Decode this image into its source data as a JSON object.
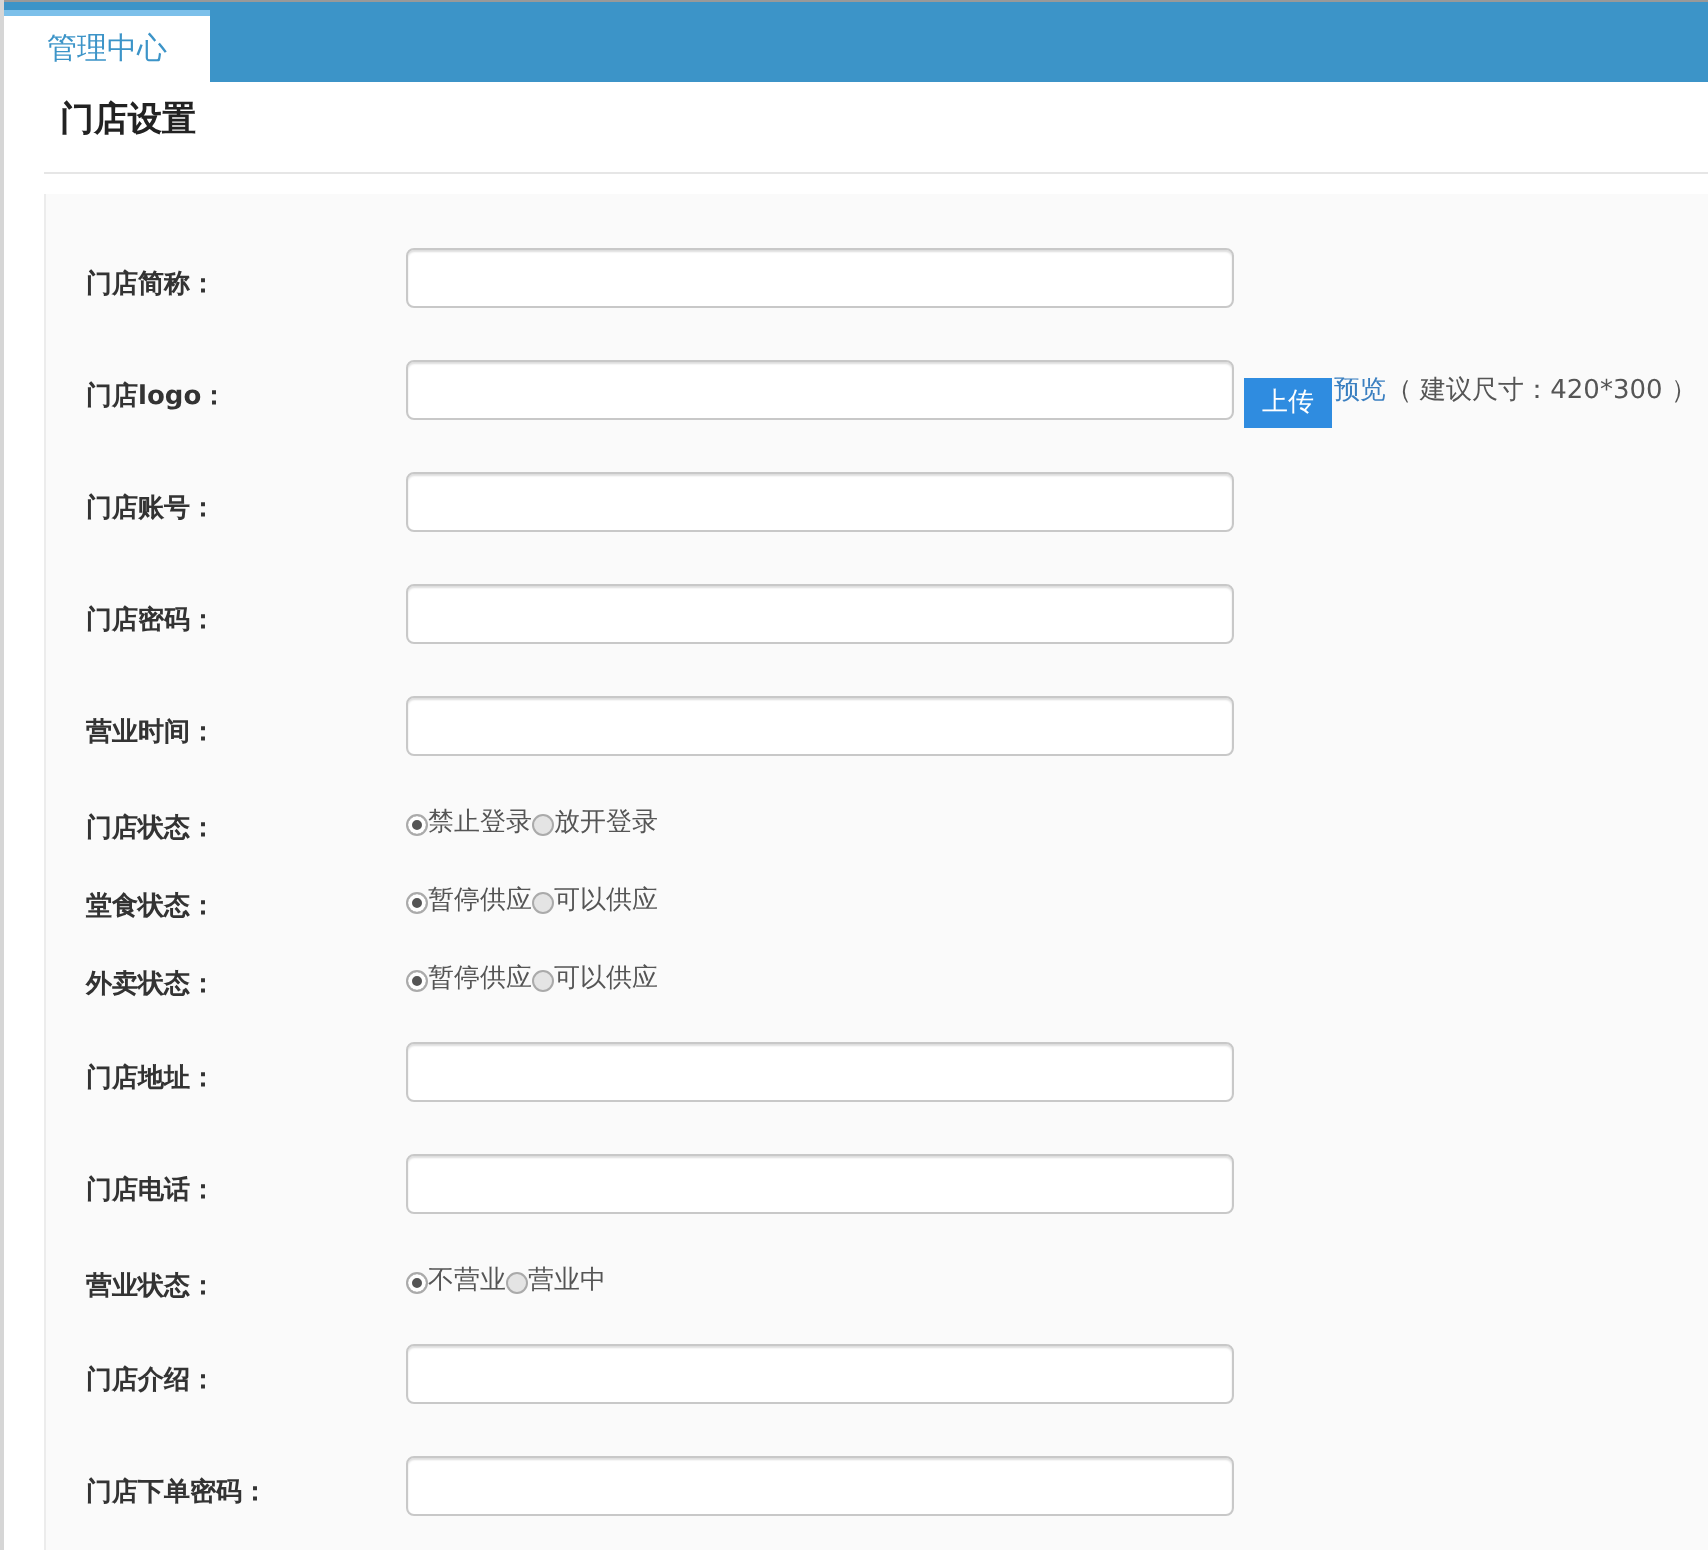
{
  "tabs": [
    {
      "label": "管理中心",
      "selected": true
    }
  ],
  "page_title": "门店设置",
  "form": [
    {
      "kind": "text",
      "label": "门店简称："
    },
    {
      "kind": "upload",
      "label": "门店logo：",
      "button": "上传",
      "link": "预览",
      "hint": "（ 建议尺寸：420*300 ）"
    },
    {
      "kind": "text",
      "label": "门店账号："
    },
    {
      "kind": "text",
      "label": "门店密码："
    },
    {
      "kind": "text",
      "label": "营业时间："
    },
    {
      "kind": "radio",
      "label": "门店状态：",
      "options": [
        {
          "label": "禁止登录",
          "selected": true
        },
        {
          "label": "放开登录",
          "selected": false
        }
      ]
    },
    {
      "kind": "radio",
      "label": "堂食状态：",
      "options": [
        {
          "label": "暂停供应",
          "selected": true
        },
        {
          "label": "可以供应",
          "selected": false
        }
      ]
    },
    {
      "kind": "radio",
      "label": "外卖状态：",
      "options": [
        {
          "label": "暂停供应",
          "selected": true
        },
        {
          "label": "可以供应",
          "selected": false
        }
      ]
    },
    {
      "kind": "text",
      "label": "门店地址："
    },
    {
      "kind": "text",
      "label": "门店电话："
    },
    {
      "kind": "radio",
      "label": "营业状态：",
      "options": [
        {
          "label": "不营业",
          "selected": true
        },
        {
          "label": "营业中",
          "selected": false
        }
      ]
    },
    {
      "kind": "text",
      "label": "门店介绍："
    },
    {
      "kind": "text",
      "label": "门店下单密码："
    }
  ]
}
